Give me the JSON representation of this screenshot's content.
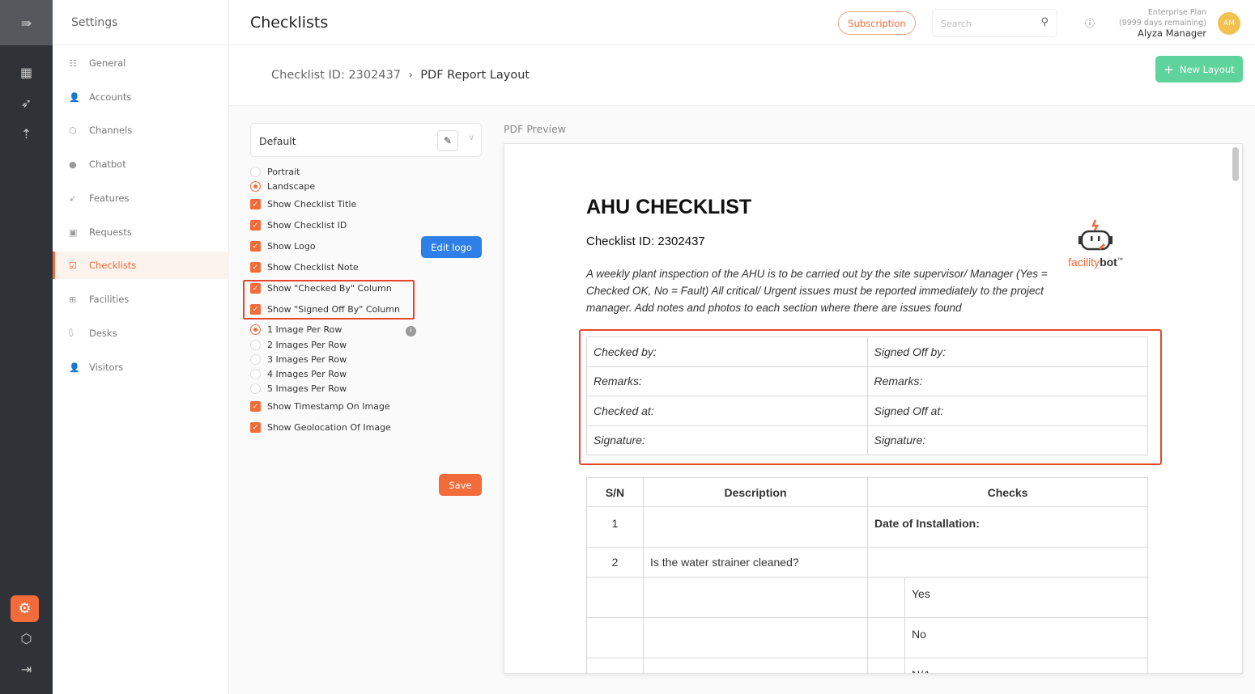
{
  "rail": {
    "icons": [
      "menu-collapse-icon",
      "dashboard-icon",
      "rocket-icon",
      "analytics-icon",
      "settings-icon",
      "cube-icon",
      "logout-icon"
    ]
  },
  "nav": {
    "title": "Settings",
    "items": [
      {
        "label": "General",
        "icon": "sliders-icon"
      },
      {
        "label": "Accounts",
        "icon": "users-icon"
      },
      {
        "label": "Channels",
        "icon": "cube-icon"
      },
      {
        "label": "Chatbot",
        "icon": "chat-icon"
      },
      {
        "label": "Features",
        "icon": "rocket-icon"
      },
      {
        "label": "Requests",
        "icon": "question-icon"
      },
      {
        "label": "Checklists",
        "icon": "checklist-icon",
        "active": true
      },
      {
        "label": "Facilities",
        "icon": "calendar-plus-icon"
      },
      {
        "label": "Desks",
        "icon": "desk-icon"
      },
      {
        "label": "Visitors",
        "icon": "visitors-icon"
      }
    ]
  },
  "header": {
    "title": "Checklists",
    "subscription": "Subscription",
    "search_placeholder": "Search",
    "plan": "Enterprise Plan",
    "days": "(9999 days remaining)",
    "user": "Alyza Manager",
    "avatar": "AM"
  },
  "breadcrumb": {
    "parent": "Checklist ID: 2302437",
    "current": "PDF Report Layout"
  },
  "new_layout": "New Layout",
  "layout_select": "Default",
  "options": {
    "portrait": "Portrait",
    "landscape": "Landscape",
    "show_title": "Show Checklist Title",
    "show_id": "Show Checklist ID",
    "show_logo": "Show Logo",
    "show_note": "Show Checklist Note",
    "checked_by": "Show \"Checked By\" Column",
    "signed_off": "Show \"Signed Off By\" Column",
    "img1": "1 Image Per Row",
    "img2": "2 Images Per Row",
    "img3": "3 Images Per Row",
    "img4": "4 Images Per Row",
    "img5": "5 Images Per Row",
    "timestamp": "Show Timestamp On Image",
    "geo": "Show Geolocation Of Image",
    "orientation": "Landscape",
    "images_per_row": 1
  },
  "edit_logo": "Edit logo",
  "save": "Save",
  "preview": {
    "label": "PDF Preview",
    "title": "AHU CHECKLIST",
    "id": "Checklist ID: 2302437",
    "logo_text": "facility",
    "logo_bold": "bot",
    "logo_tm": "™",
    "note": "A weekly plant inspection of the AHU is to be carried out by the site supervisor/ Manager (Yes = Checked OK, No = Fault) All critical/ Urgent issues must be reported immediately to the project manager. Add notes and photos to each section where there are issues found",
    "sign": [
      [
        "Checked by:",
        "Signed Off by:"
      ],
      [
        "Remarks:",
        "Remarks:"
      ],
      [
        "Checked at:",
        "Signed Off at:"
      ],
      [
        "Signature:",
        "Signature:"
      ]
    ],
    "headers": [
      "S/N",
      "Description",
      "Checks"
    ],
    "rows": [
      {
        "sn": "1",
        "desc": "",
        "check": "Date of Installation:"
      },
      {
        "sn": "2",
        "desc": "Is the water strainer cleaned?",
        "check": ""
      }
    ],
    "answers": [
      "Yes",
      "No",
      "N/A"
    ]
  },
  "colors": {
    "accent": "#f26b3a",
    "green": "#5fd39c",
    "blue": "#2f7fe8",
    "highlight": "#e5472c"
  }
}
